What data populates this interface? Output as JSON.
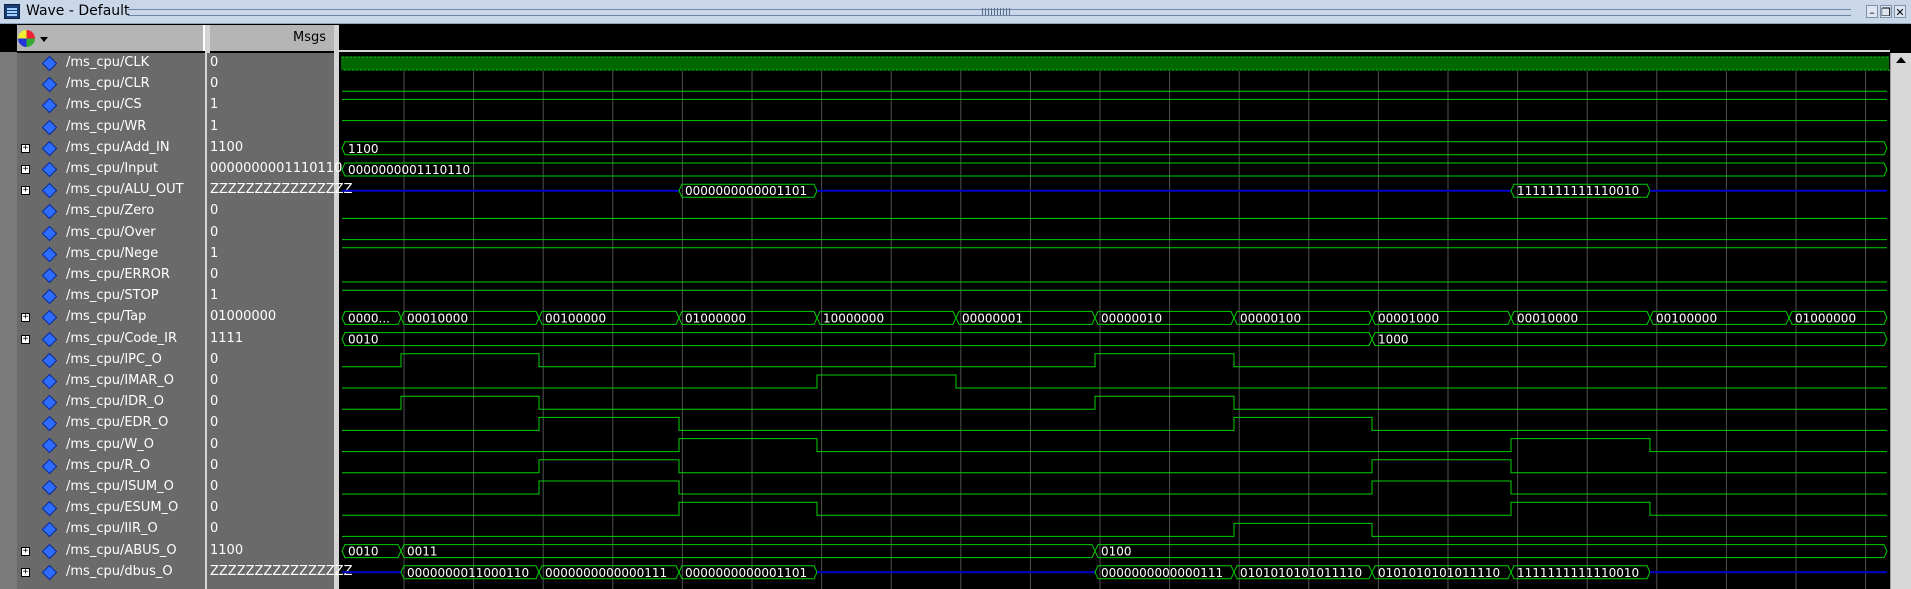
{
  "window": {
    "title": "Wave - Default"
  },
  "columns": {
    "msgs": "Msgs"
  },
  "signals": [
    {
      "name": "/ms_cpu/CLK",
      "value": "0",
      "bus": false
    },
    {
      "name": "/ms_cpu/CLR",
      "value": "0",
      "bus": false
    },
    {
      "name": "/ms_cpu/CS",
      "value": "1",
      "bus": false
    },
    {
      "name": "/ms_cpu/WR",
      "value": "1",
      "bus": false
    },
    {
      "name": "/ms_cpu/Add_IN",
      "value": "1100",
      "bus": true
    },
    {
      "name": "/ms_cpu/Input",
      "value": "0000000001110110",
      "bus": true
    },
    {
      "name": "/ms_cpu/ALU_OUT",
      "value": "ZZZZZZZZZZZZZZZZ",
      "bus": true
    },
    {
      "name": "/ms_cpu/Zero",
      "value": "0",
      "bus": false
    },
    {
      "name": "/ms_cpu/Over",
      "value": "0",
      "bus": false
    },
    {
      "name": "/ms_cpu/Nege",
      "value": "1",
      "bus": false
    },
    {
      "name": "/ms_cpu/ERROR",
      "value": "0",
      "bus": false
    },
    {
      "name": "/ms_cpu/STOP",
      "value": "1",
      "bus": false
    },
    {
      "name": "/ms_cpu/Tap",
      "value": "01000000",
      "bus": true
    },
    {
      "name": "/ms_cpu/Code_IR",
      "value": "1111",
      "bus": true
    },
    {
      "name": "/ms_cpu/IPC_O",
      "value": "0",
      "bus": false
    },
    {
      "name": "/ms_cpu/IMAR_O",
      "value": "0",
      "bus": false
    },
    {
      "name": "/ms_cpu/IDR_O",
      "value": "0",
      "bus": false
    },
    {
      "name": "/ms_cpu/EDR_O",
      "value": "0",
      "bus": false
    },
    {
      "name": "/ms_cpu/W_O",
      "value": "0",
      "bus": false
    },
    {
      "name": "/ms_cpu/R_O",
      "value": "0",
      "bus": false
    },
    {
      "name": "/ms_cpu/ISUM_O",
      "value": "0",
      "bus": false
    },
    {
      "name": "/ms_cpu/ESUM_O",
      "value": "0",
      "bus": false
    },
    {
      "name": "/ms_cpu/IIR_O",
      "value": "0",
      "bus": false
    },
    {
      "name": "/ms_cpu/ABUS_O",
      "value": "1100",
      "bus": true
    },
    {
      "name": "/ms_cpu/dbus_O",
      "value": "ZZZZZZZZZZZZZZZZ",
      "bus": true
    }
  ],
  "wave_labels": {
    "add_in": [
      "1100"
    ],
    "input": [
      "0000000001110110"
    ],
    "alu_out": [
      "0000000000001101",
      "1111111111110010"
    ],
    "tap": [
      "0000...",
      "00010000",
      "00100000",
      "01000000",
      "10000000",
      "00000001",
      "00000010",
      "00000100",
      "00001000",
      "00010000",
      "00100000",
      "01000000"
    ],
    "code_ir": [
      "0010",
      "1000"
    ],
    "abus_o": [
      "0010",
      "0011",
      "0100"
    ],
    "dbus_o": [
      "0000000011000110",
      "0000000000000111",
      "0000000000001101",
      "0000000000000111",
      "0101010101011110",
      "0101010101011110",
      "1111111111110010"
    ]
  },
  "colors": {
    "wave": "#00d000",
    "bus_z": "#0000c8",
    "label": "#ffffff"
  }
}
